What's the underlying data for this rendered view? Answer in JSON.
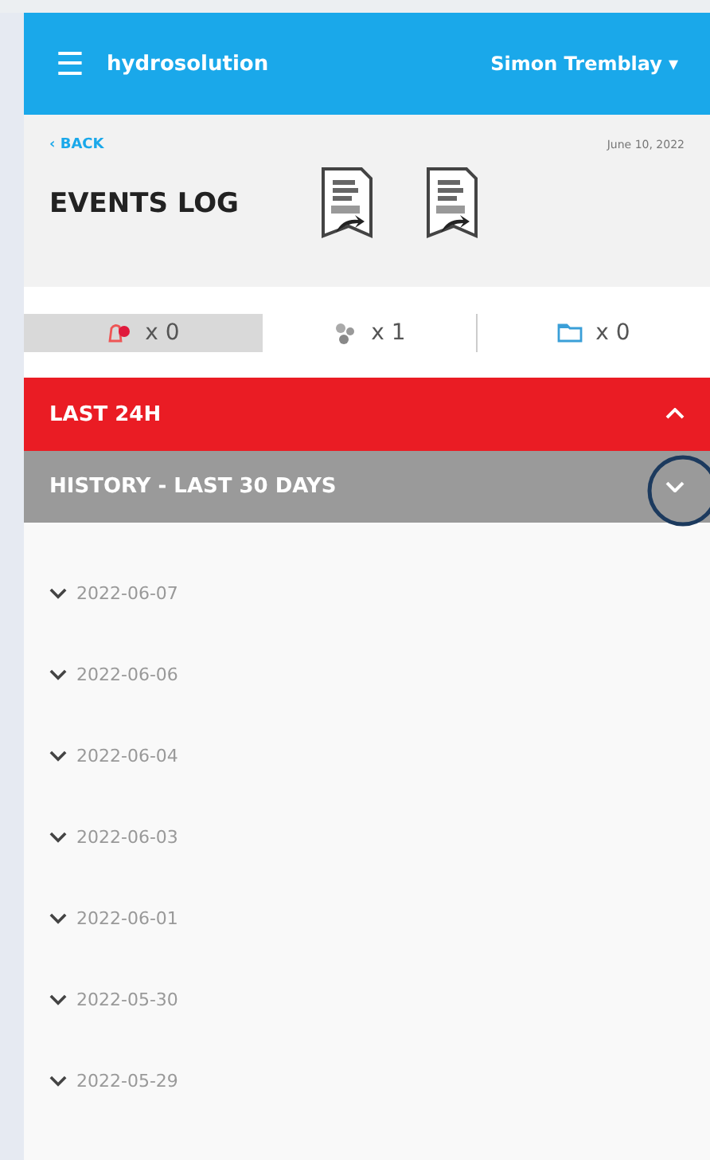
{
  "top_bar": {
    "menu_icon": "☰",
    "brand": "hydrosolution",
    "user": "Simon Tremblay",
    "user_caret": "▾"
  },
  "header": {
    "back": "‹ BACK",
    "date": "June 10, 2022",
    "title": "EVENTS LOG",
    "exports": [
      {
        "kind": "csv"
      },
      {
        "kind": "csv"
      }
    ]
  },
  "filters": [
    {
      "kind": "alarm",
      "count": "x 0",
      "selected": true
    },
    {
      "kind": "cluster",
      "count": "x 1",
      "selected": false
    },
    {
      "kind": "folder",
      "count": "x 0",
      "selected": false
    }
  ],
  "sections": [
    {
      "label": "LAST 24H",
      "expanded": true,
      "highlighted": false
    },
    {
      "label": "HISTORY - LAST 30 DAYS",
      "expanded": false,
      "highlighted": true
    }
  ],
  "days": [
    {
      "label": "2022-06-07",
      "expanded": false
    },
    {
      "label": "2022-06-06",
      "expanded": false
    },
    {
      "label": "2022-06-04",
      "expanded": false
    },
    {
      "label": "2022-06-03",
      "expanded": false
    },
    {
      "label": "2022-06-01",
      "expanded": false
    },
    {
      "label": "2022-05-30",
      "expanded": false
    },
    {
      "label": "2022-05-29",
      "expanded": false
    }
  ]
}
